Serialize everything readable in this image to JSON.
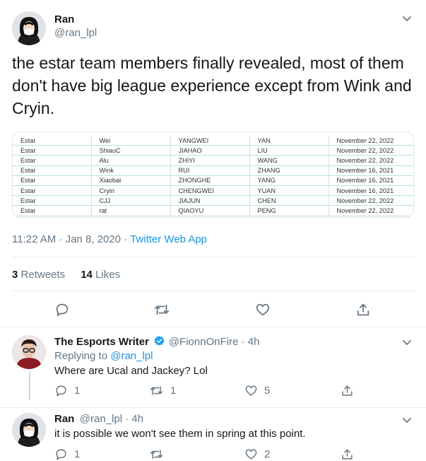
{
  "main_tweet": {
    "name": "Ran",
    "handle": "@ran_lpl",
    "text": "the estar team members finally revealed, most of them don't have big league experience except from Wink and Cryin.",
    "sheet_rows": [
      [
        "Estar",
        "Wei",
        "YANGWEI",
        "YAN",
        "November 22, 2022"
      ],
      [
        "Estar",
        "ShiauC",
        "JIAHAO",
        "LIU",
        "November 22, 2022"
      ],
      [
        "Estar",
        "Alu",
        "ZHIYI",
        "WANG",
        "November 22, 2022"
      ],
      [
        "Estar",
        "Wink",
        "RUI",
        "ZHANG",
        "November 16, 2021"
      ],
      [
        "Estar",
        "Xiaobai",
        "ZHONGHE",
        "YANG",
        "November 16, 2021"
      ],
      [
        "Estar",
        "Cryin",
        "CHENGWEI",
        "YUAN",
        "November 16, 2021"
      ],
      [
        "Estar",
        "CJJ",
        "JIAJUN",
        "CHEN",
        "November 22, 2022"
      ],
      [
        "Estar",
        "rat",
        "QIAOYU",
        "PENG",
        "November 22, 2022"
      ]
    ],
    "timestamp": "11:22 AM · Jan 8, 2020 · ",
    "source": "Twitter Web App",
    "retweets_count": "3",
    "retweets_label": "Retweets",
    "likes_count": "14",
    "likes_label": "Likes"
  },
  "reply1": {
    "name": "The Esports Writer",
    "handle": "@FionnOnFire · 4h",
    "replying_prefix": "Replying to ",
    "replying_to": "@ran_lpl",
    "text": "Where are Ucal and Jackey? Lol",
    "reply_count": "1",
    "retweet_count": "1",
    "like_count": "5"
  },
  "reply2": {
    "name": "Ran",
    "handle": "@ran_lpl · 4h",
    "text": "it is possible we won't see them in spring at this point.",
    "reply_count": "1",
    "retweet_count": "",
    "like_count": "2"
  },
  "icons": {
    "more": "chevron-down-icon",
    "reply": "speech-bubble-icon",
    "retweet": "retweet-arrows-icon",
    "like": "heart-icon",
    "share": "share-upload-icon",
    "verified": "verified-badge-icon"
  },
  "colors": {
    "link": "#1b95e0",
    "muted": "#657786",
    "verified": "#1da1f2"
  }
}
